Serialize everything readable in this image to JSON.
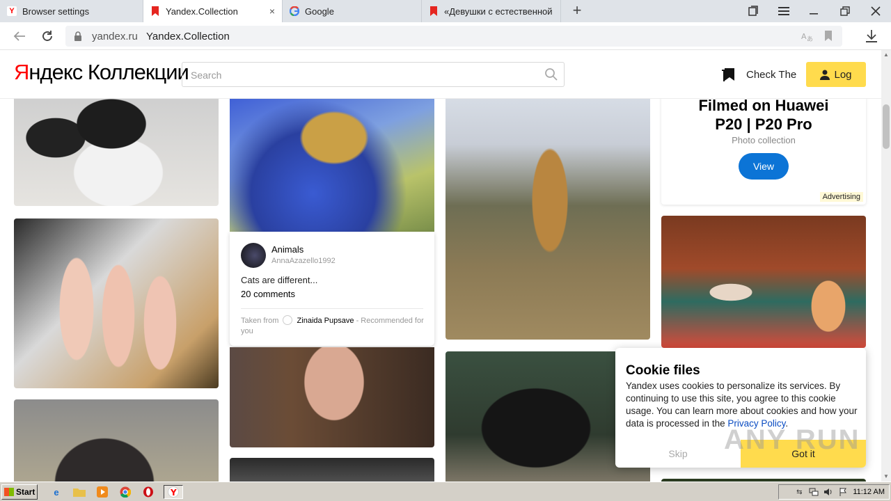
{
  "browser": {
    "tabs": [
      {
        "label": "Browser settings",
        "icon": "yandex-icon"
      },
      {
        "label": "Yandex.Collection",
        "icon": "yandex-collections-icon",
        "active": true
      },
      {
        "label": "Google",
        "icon": "google-icon"
      },
      {
        "label": "«Девушки с естественной",
        "icon": "yandex-collections-icon"
      }
    ],
    "close_glyph": "×",
    "new_tab_glyph": "+",
    "url_domain": "yandex.ru",
    "url_title": "Yandex.Collection"
  },
  "header": {
    "logo_y": "Я",
    "logo_rest": "ндекс Коллекции",
    "search_placeholder": "Search",
    "check_text": "Check The",
    "login_label": "Log"
  },
  "post": {
    "collection": "Animals",
    "user": "AnnaAzazello1992",
    "description": "Cats are different...",
    "comments": "20 comments",
    "taken_prefix": "Taken from",
    "taken_user": "Zinaida Pupsave",
    "taken_suffix": "- Recommended for you"
  },
  "ad": {
    "title_line1": "Filmed on Huawei",
    "title_line2": "P20 | P20 Pro",
    "subtitle": "Photo collection",
    "button": "View",
    "tag": "Advertising"
  },
  "cookie": {
    "title": "Cookie files",
    "text": "Yandex uses cookies to personalize its services. By continuing to use this site, you agree to this cookie usage. You can learn more about cookies and how your data is processed in the",
    "link": "Privacy Policy",
    "text_end": ".",
    "skip": "Skip",
    "accept": "Got it"
  },
  "watermark": "ANY RUN",
  "taskbar": {
    "start_label": "Start",
    "clock": "11:12 AM"
  },
  "colors": {
    "accent_yellow": "#ffdb4d",
    "ad_button_blue": "#0c74d6",
    "logo_red": "#ff0000"
  }
}
